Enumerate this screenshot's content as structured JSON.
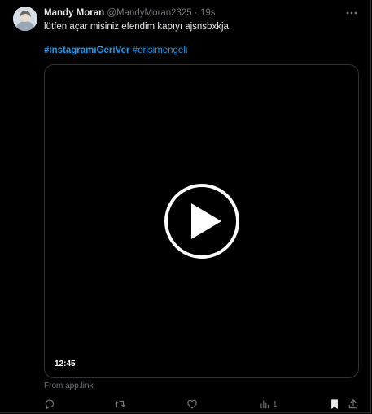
{
  "tweet": {
    "display_name": "Mandy Moran",
    "handle": "@MandyMoran2325",
    "separator": " · ",
    "time": "19s",
    "text": "lütfen açar misiniz efendim kapıyı ajsnsbxkja",
    "hashtags": [
      "#instagramıGeriVer",
      "#erisimengeli"
    ],
    "video_duration": "12:45",
    "source": "From app.link",
    "views_count": "1"
  },
  "icons": {
    "more": "more-horizontal-icon",
    "play": "play-icon",
    "reply": "reply-icon",
    "retweet": "retweet-icon",
    "like": "heart-icon",
    "views": "views-chart-icon",
    "bookmark": "bookmark-icon",
    "share": "share-icon"
  },
  "colors": {
    "background": "#000000",
    "text": "#e7e9ea",
    "muted": "#71767b",
    "link": "#1d9bf0",
    "border": "#2f3336"
  }
}
